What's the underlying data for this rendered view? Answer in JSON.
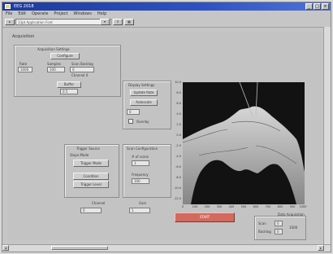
{
  "window": {
    "title": "EEG 2018",
    "min": "_",
    "max": "□",
    "close": "×"
  },
  "menu": [
    "File",
    "Edit",
    "Operate",
    "Project",
    "Windows",
    "Help"
  ],
  "toolbar": {
    "font": "13pt Application Font",
    "buttons": [
      "▾",
      "⇕",
      "▦"
    ]
  },
  "client_label": "Acquisition",
  "acq": {
    "title": "Acquisition Settings",
    "config_btn": "Configure",
    "sub_labels": [
      "Rate",
      "Samples",
      "Scan Backlog"
    ],
    "rate": "1000",
    "samples": "100",
    "backlog": "0",
    "channel": "Channel 0",
    "buffer_btn": "Buffer",
    "buffer_value": "0.5"
  },
  "display": {
    "title": "Display Settings",
    "btn1": "Update Rate",
    "btn2": "Autoscale",
    "value": "0",
    "check_label": "Overlay"
  },
  "trigger": {
    "title": "Trigger Source",
    "sub": "Slope Mode",
    "btn1": "Trigger Mode",
    "btn2": "Condition",
    "btn3": "Trigger Level"
  },
  "scan": {
    "title": "Scan Configuration",
    "label1": "# of scans",
    "value1": "1",
    "label2": "Frequency",
    "value2": "100"
  },
  "bottom_left": {
    "label": "Channel",
    "value": "0"
  },
  "bottom_mid": {
    "label": "Gain",
    "value": "1"
  },
  "start_button": "START",
  "stats": {
    "label": "Data Acquisition",
    "row1_label": "Scan",
    "row1_value": "0",
    "row2_label": "Backlog",
    "row2_value": "0",
    "row3_value": "1000"
  },
  "plot": {
    "yticks": [
      "10.0",
      "8.0",
      "6.0",
      "4.0",
      "2.0",
      "0.0",
      "-2.0",
      "-4.0",
      "-6.0",
      "-8.0",
      "-10.0",
      "-12.0"
    ],
    "xticks": [
      "0",
      "100",
      "200",
      "300",
      "400",
      "500",
      "600",
      "700",
      "800",
      "900",
      "1000"
    ]
  },
  "colors": {
    "accent": "#2d52c0",
    "plot_bg": "#121212",
    "trace": "#d4d4d4",
    "start": "#d26a5d"
  }
}
